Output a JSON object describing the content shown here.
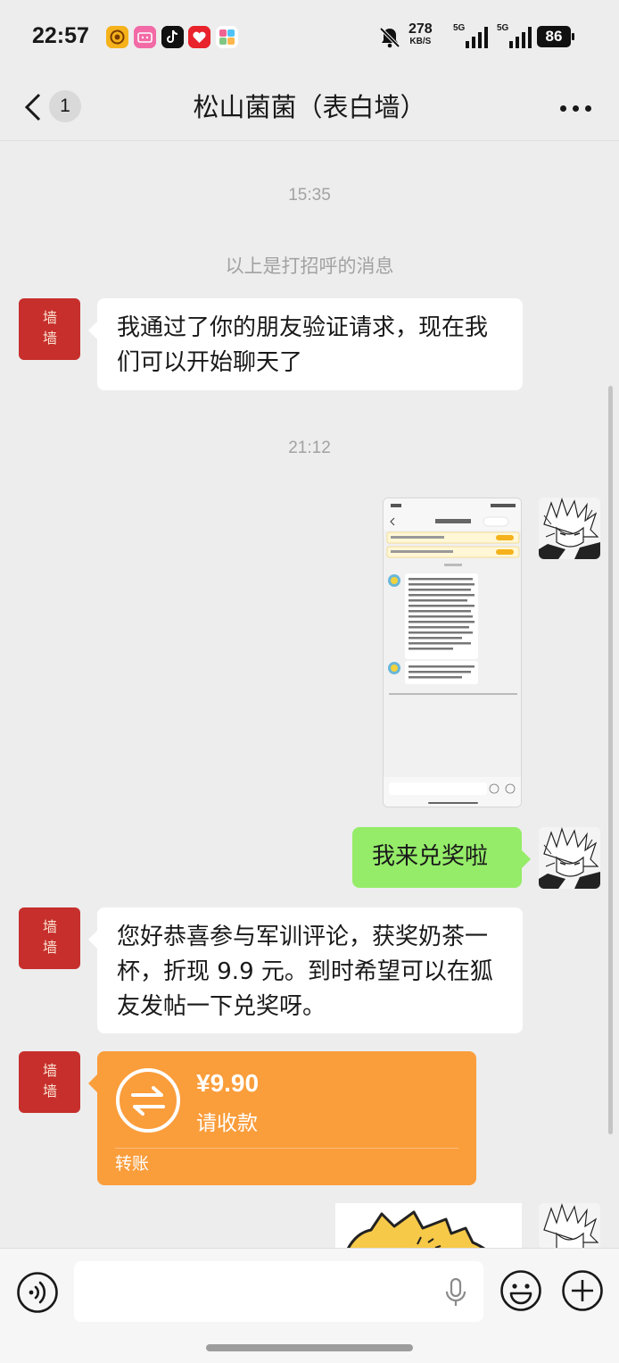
{
  "status_bar": {
    "time": "22:57",
    "net_speed": "278",
    "net_unit": "KB/S",
    "signal1_label": "5G",
    "signal2_label": "5G",
    "battery": "86",
    "icons": [
      "app-icon-target",
      "bilibili-icon",
      "tiktok-icon",
      "heart-app-icon",
      "puzzle-app-icon",
      "mute-bell-icon",
      "signal-icon",
      "signal-icon",
      "battery-icon"
    ]
  },
  "nav": {
    "unread_count": "1",
    "title": "松山菌菌（表白墙）"
  },
  "messages": {
    "time1": "15:35",
    "greeting_note": "以上是打招呼的消息",
    "msg1": "我通过了你的朋友验证请求，现在我们可以开始聊天了",
    "time2": "21:12",
    "msg_out1": "我来兑奖啦",
    "msg2": "您好恭喜参与军训评论，获奖奶茶一杯，折现 9.9 元。到时希望可以在狐友发帖一下兑奖呀。",
    "transfer": {
      "amount": "¥9.90",
      "status": "请收款",
      "footer": "转账"
    }
  },
  "sender_avatar_glyph": "墙",
  "colors": {
    "background": "#ededed",
    "bubble_out": "#95ec69",
    "bubble_in": "#ffffff",
    "transfer": "#fa9d3b",
    "avatar_red": "#c62f2c"
  }
}
